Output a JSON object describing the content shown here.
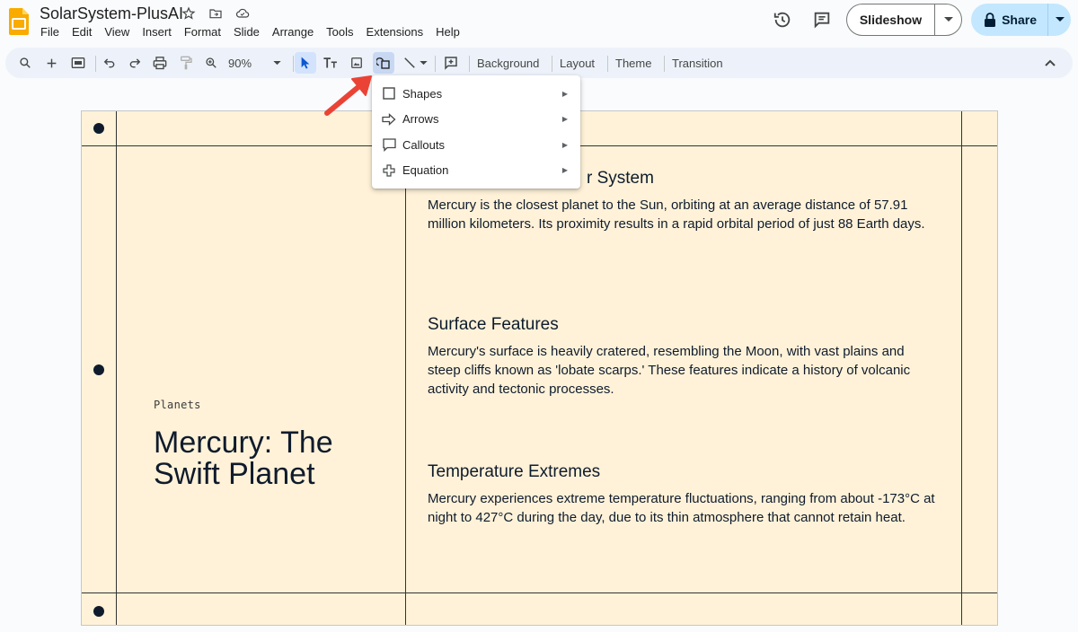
{
  "header": {
    "title": "SolarSystem-PlusAI",
    "menu": [
      "File",
      "Edit",
      "View",
      "Insert",
      "Format",
      "Slide",
      "Arrange",
      "Tools",
      "Extensions",
      "Help"
    ],
    "slideshow_label": "Slideshow",
    "share_label": "Share"
  },
  "toolbar": {
    "zoom": "90%",
    "background": "Background",
    "layout": "Layout",
    "theme": "Theme",
    "transition": "Transition"
  },
  "shape_menu": {
    "items": [
      {
        "label": "Shapes",
        "icon": "square-icon"
      },
      {
        "label": "Arrows",
        "icon": "arrow-icon"
      },
      {
        "label": "Callouts",
        "icon": "callout-icon"
      },
      {
        "label": "Equation",
        "icon": "plus-icon"
      }
    ]
  },
  "slide": {
    "eyebrow": "Planets",
    "title": "Mercury: The Swift Planet",
    "sections": [
      {
        "heading": "r System",
        "body": "Mercury is the closest planet to the Sun, orbiting at an average distance of 57.91 million kilometers. Its proximity results in a rapid orbital period of just 88 Earth days."
      },
      {
        "heading": "Surface Features",
        "body": "Mercury's surface is heavily cratered, resembling the Moon, with vast plains and steep cliffs known as 'lobate scarps.' These features indicate a history of volcanic activity and tectonic processes."
      },
      {
        "heading": "Temperature Extremes",
        "body": "Mercury experiences extreme temperature fluctuations, ranging from about -173°C at night to 427°C during the day, due to its thin atmosphere that cannot retain heat."
      }
    ]
  },
  "colors": {
    "slide_bg": "#fff2d8",
    "ink": "#0f1b2d",
    "share_bg": "#c2e7ff",
    "toolbar_bg": "#edf2fa",
    "annotation": "#ea4335"
  }
}
